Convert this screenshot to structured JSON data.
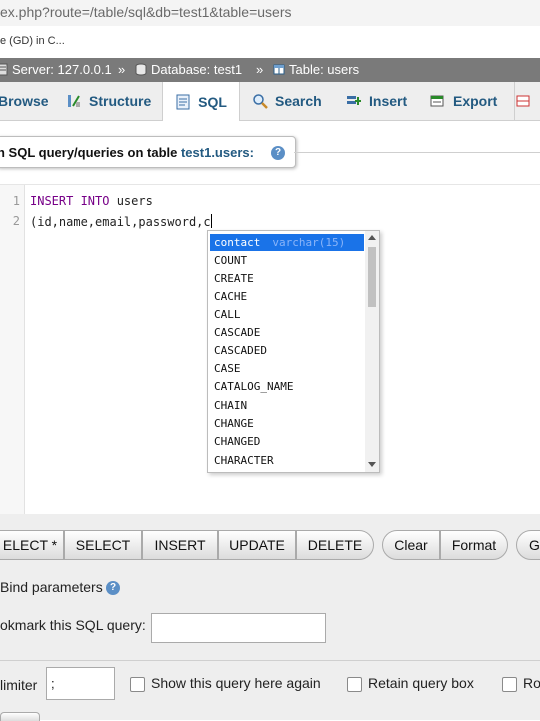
{
  "browser": {
    "url": "ex.php?route=/table/sql&db=test1&table=users",
    "tab_title": "e (GD) in C..."
  },
  "breadcrumb": {
    "server": "Server: 127.0.0.1",
    "database": "Database: test1",
    "table": "Table: users",
    "separator": "»"
  },
  "tabs": [
    {
      "label": "Browse",
      "icon": "browse-icon"
    },
    {
      "label": "Structure",
      "icon": "structure-icon"
    },
    {
      "label": "SQL",
      "icon": "sql-icon",
      "active": true
    },
    {
      "label": "Search",
      "icon": "search-icon"
    },
    {
      "label": "Insert",
      "icon": "insert-icon"
    },
    {
      "label": "Export",
      "icon": "export-icon"
    }
  ],
  "legend": {
    "prefix": "n SQL query/queries on table ",
    "table": "test1.users:",
    "help": "?"
  },
  "editor": {
    "line_numbers": [
      "1",
      "2"
    ],
    "line1_keyword": "INSERT INTO",
    "line1_rest": " users",
    "line2": "(id,name,email,password,c"
  },
  "autocomplete": {
    "selected_label": "contact",
    "selected_hint": "varchar(15)",
    "items": [
      "COUNT",
      "CREATE",
      "CACHE",
      "CALL",
      "CASCADE",
      "CASCADED",
      "CASE",
      "CATALOG_NAME",
      "CHAIN",
      "CHANGE",
      "CHANGED",
      "CHARACTER"
    ]
  },
  "buttons": {
    "select_star": "ELECT *",
    "select": "SELECT",
    "insert": "INSERT",
    "update": "UPDATE",
    "delete": "DELETE",
    "clear": "Clear",
    "format": "Format",
    "get": "G"
  },
  "options": {
    "bind_parameters": "Bind parameters",
    "bookmark_label": "okmark this SQL query:",
    "delimiter_label": "limiter",
    "delimiter_value": ";",
    "show_query_again": "Show this query here again",
    "retain_query_box": "Retain query box",
    "rollback_partial": "Ro"
  },
  "colors": {
    "link_blue": "#235a81",
    "breadcrumb_bg": "#7a7a7a",
    "ac_selected": "#1a73e8",
    "keyword": "#770088"
  }
}
